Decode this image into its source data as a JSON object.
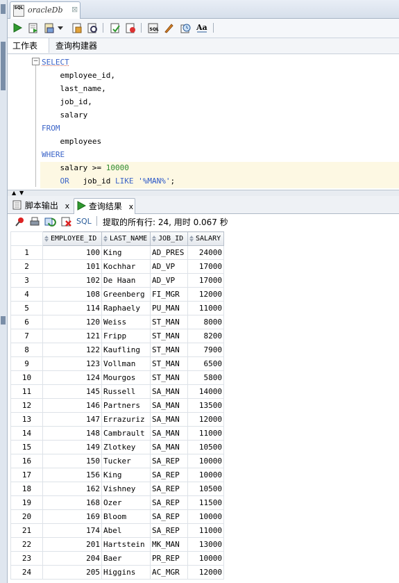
{
  "document_tab": {
    "title": "oracleDb",
    "close_symbol": "⊠",
    "icon_text": "SQL"
  },
  "toolbar": {
    "icons": [
      "run-statement-icon",
      "run-script-icon",
      "commit-icon",
      "dropdown-icon",
      "autotrace-icon",
      "explain-plan-icon",
      "rollback-icon",
      "cancel-icon",
      "sql-tuning-icon",
      "clear-icon",
      "history-icon",
      "format-case-icon"
    ]
  },
  "editor_tabs": {
    "worksheet": "工作表",
    "query_builder": "查询构建器"
  },
  "editor": {
    "lines": [
      {
        "kind": "keyword",
        "text": "SELECT"
      },
      {
        "kind": "plain",
        "text": "    employee_id,"
      },
      {
        "kind": "plain",
        "text": "    last_name,"
      },
      {
        "kind": "plain",
        "text": "    job_id,"
      },
      {
        "kind": "plain",
        "text": "    salary"
      },
      {
        "kind": "keyword",
        "text": "FROM"
      },
      {
        "kind": "plain",
        "text": "    employees"
      },
      {
        "kind": "keyword",
        "text": "WHERE"
      },
      {
        "kind": "cond1",
        "text": "    salary >= ",
        "num": "10000"
      },
      {
        "kind": "cond2",
        "kw": "    OR",
        "mid": "   job_id ",
        "kw2": "LIKE",
        "str": " '%MAN%'",
        "end": ";"
      }
    ],
    "highlighted_line": 9
  },
  "result_tabs": {
    "script_output": "脚本输出",
    "query_result": "查询结果",
    "close": "x"
  },
  "result_toolbar": {
    "sql_label": "SQL",
    "status": "提取的所有行: 24, 用时 0.067 秒"
  },
  "grid": {
    "columns": [
      "EMPLOYEE_ID",
      "LAST_NAME",
      "JOB_ID",
      "SALARY"
    ],
    "rows": [
      [
        "1",
        "100",
        "King",
        "AD_PRES",
        "24000"
      ],
      [
        "2",
        "101",
        "Kochhar",
        "AD_VP",
        "17000"
      ],
      [
        "3",
        "102",
        "De Haan",
        "AD_VP",
        "17000"
      ],
      [
        "4",
        "108",
        "Greenberg",
        "FI_MGR",
        "12000"
      ],
      [
        "5",
        "114",
        "Raphaely",
        "PU_MAN",
        "11000"
      ],
      [
        "6",
        "120",
        "Weiss",
        "ST_MAN",
        "8000"
      ],
      [
        "7",
        "121",
        "Fripp",
        "ST_MAN",
        "8200"
      ],
      [
        "8",
        "122",
        "Kaufling",
        "ST_MAN",
        "7900"
      ],
      [
        "9",
        "123",
        "Vollman",
        "ST_MAN",
        "6500"
      ],
      [
        "10",
        "124",
        "Mourgos",
        "ST_MAN",
        "5800"
      ],
      [
        "11",
        "145",
        "Russell",
        "SA_MAN",
        "14000"
      ],
      [
        "12",
        "146",
        "Partners",
        "SA_MAN",
        "13500"
      ],
      [
        "13",
        "147",
        "Errazuriz",
        "SA_MAN",
        "12000"
      ],
      [
        "14",
        "148",
        "Cambrault",
        "SA_MAN",
        "11000"
      ],
      [
        "15",
        "149",
        "Zlotkey",
        "SA_MAN",
        "10500"
      ],
      [
        "16",
        "150",
        "Tucker",
        "SA_REP",
        "10000"
      ],
      [
        "17",
        "156",
        "King",
        "SA_REP",
        "10000"
      ],
      [
        "18",
        "162",
        "Vishney",
        "SA_REP",
        "10500"
      ],
      [
        "19",
        "168",
        "Ozer",
        "SA_REP",
        "11500"
      ],
      [
        "20",
        "169",
        "Bloom",
        "SA_REP",
        "10000"
      ],
      [
        "21",
        "174",
        "Abel",
        "SA_REP",
        "11000"
      ],
      [
        "22",
        "201",
        "Hartstein",
        "MK_MAN",
        "13000"
      ],
      [
        "23",
        "204",
        "Baer",
        "PR_REP",
        "10000"
      ],
      [
        "24",
        "205",
        "Higgins",
        "AC_MGR",
        "12000"
      ]
    ]
  }
}
